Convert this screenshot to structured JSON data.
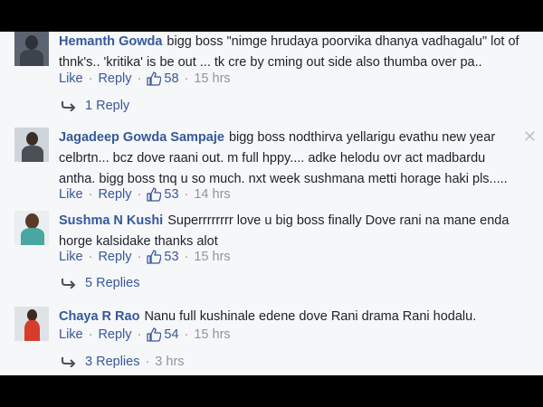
{
  "comments": [
    {
      "author": "Hemanth Gowda",
      "text": "bigg boss \"nimge hrudaya poorvika dhanya vadhagalu\" lot of thnk's.. 'kritika' is be out ... tk cre by cming out side also thumba over pa..",
      "like_label": "Like",
      "reply_label": "Reply",
      "likes": "58",
      "time": "15 hrs",
      "replies_label": "1 Reply",
      "replies_time": ""
    },
    {
      "author": "Jagadeep Gowda Sampaje",
      "text": "bigg boss nodthirva yellarigu evathu new year celbrtn... bcz dove raani out. m full hppy.... adke helodu ovr act madbardu antha. bigg boss tnq u so much. nxt week sushmana metti horage haki pls.....",
      "like_label": "Like",
      "reply_label": "Reply",
      "likes": "53",
      "time": "14 hrs"
    },
    {
      "author": "Sushma N Kushi",
      "text": "Superrrrrrrr love u big boss finally Dove rani na mane enda horge kalsidake thanks alot",
      "like_label": "Like",
      "reply_label": "Reply",
      "likes": "53",
      "time": "15 hrs",
      "replies_label": "5 Replies",
      "replies_time": ""
    },
    {
      "author": "Chaya R Rao",
      "text": "Nanu full kushinale edene dove Rani drama Rani hodalu.",
      "like_label": "Like",
      "reply_label": "Reply",
      "likes": "54",
      "time": "15 hrs",
      "replies_label": "3 Replies",
      "replies_time": "3 hrs"
    }
  ],
  "close_glyph": "✕",
  "colors": {
    "link": "#365899",
    "meta": "#90949c",
    "background": "#f6f7f9"
  }
}
